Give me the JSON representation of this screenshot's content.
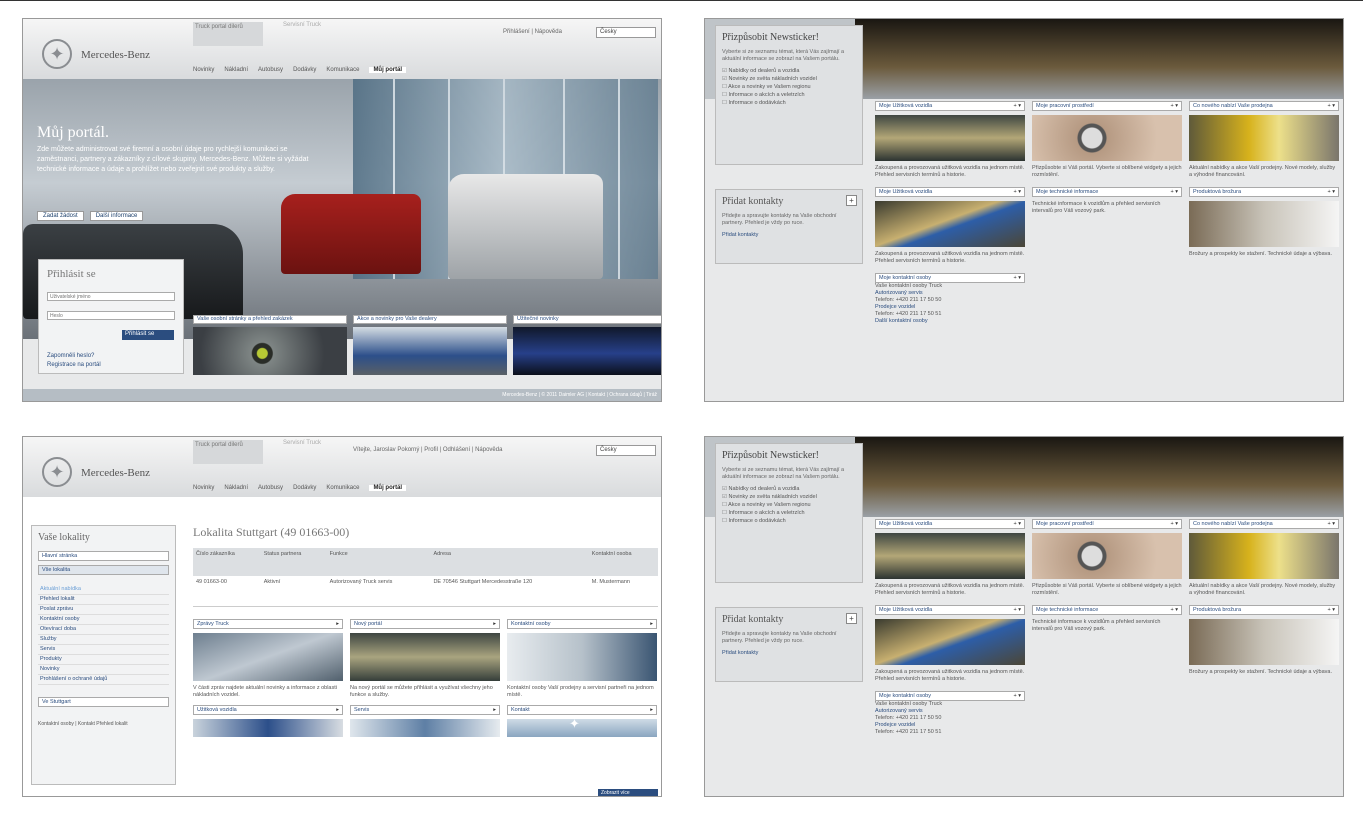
{
  "brand": {
    "name": "Mercedes-Benz"
  },
  "header": {
    "tab_active": "Truck portal\ndilerů",
    "tab_inactive": "Servisní Truck",
    "links_p1": "Přihlášení | Nápověda",
    "links_p3": "Vítejte, Jaroslav Pokorný | Profil | Odhlášení | Nápověda",
    "lang": "Česky",
    "nav": [
      "Novinky",
      "Nákladní",
      "Autobusy",
      "Dodávky",
      "Komunikace",
      "Můj portál"
    ]
  },
  "hero": {
    "title": "Můj portál.",
    "text": "Zde můžete administrovat své firemní a osobní údaje pro rychlejší komunikaci se zaměstnanci, partnery a zákazníky z cílové skupiny. Mercedes-Benz. Můžete si vyžádat technické informace a údaje a prohlížet nebo zveřejnit své produkty a služby.",
    "btn_register": "Zadat žádost",
    "btn_how": "Další informace"
  },
  "login": {
    "title": "Přihlásit se",
    "user_placeholder": "Uživatelské jméno",
    "pass_placeholder": "Heslo",
    "button": "Přihlásit se",
    "link_forgot": "Zapomněli heslo?",
    "link_register": "Registrace na portál"
  },
  "teasers": [
    "Vaše osobní stránky a přehled zakázek",
    "Akce a novinky pro Vaše dealery",
    "Užitečné novinky"
  ],
  "footer": "Mercedes-Benz | © 2011 Daimler AG | Kontakt | Ochrana údajů | Tiráž",
  "newsticker": {
    "title": "Přizpůsobit Newsticker!",
    "intro": "Vyberte si ze seznamu témat, která Vás zajímají a aktuální informace se zobrazí na Vašem portálu.",
    "options": [
      {
        "label": "Nabídky od dealerů a vozidla",
        "checked": true
      },
      {
        "label": "Novinky ze světa nákladních vozidel",
        "checked": true
      },
      {
        "label": "Akce a novinky ve Vašem regionu",
        "checked": false
      },
      {
        "label": "Informace o akcích a veletrzích",
        "checked": false
      },
      {
        "label": "Informace o dodávkách",
        "checked": false
      }
    ]
  },
  "quicklink": {
    "title": "Přidat kontakty",
    "text": "Přidejte a spravujte kontakty na Vaše obchodní partnery. Přehled je vždy po ruce.",
    "link": "Přidat kontakty"
  },
  "widgets": [
    {
      "title": "Moje Užitková vozidla",
      "text": "Zakoupená a provozovaná užitková vozidla na jednom místě. Přehled servisních termínů a historie."
    },
    {
      "title": "Moje pracovní prostředí",
      "text": "Přizpůsobte si Váš portál. Vyberte si oblíbené widgety a jejich rozmístění."
    },
    {
      "title": "Co nového nabízí Vaše prodejna",
      "text": "Aktuální nabídky a akce Vaší prodejny. Nové modely, služby a výhodné financování."
    },
    {
      "title": "Moje Užitková vozidla",
      "text": "Zakoupená a provozovaná užitková vozidla na jednom místě. Přehled servisních termínů a historie."
    },
    {
      "title": "Moje technické informace",
      "text": "Technické informace k vozidlům a přehled servisních intervalů pro Váš vozový park."
    },
    {
      "title": "Produktová brožura",
      "text": "Brožury a prospekty ke stažení. Technické údaje a výbava."
    }
  ],
  "contacts_widget": {
    "title": "Moje kontaktní osoby",
    "line1": "Vaše kontaktní osoby Truck",
    "line2": "Autorizovaný servis",
    "line3": "Telefon: +420 211 17 50 50",
    "line4": "Prodejce vozidel",
    "line5": "Telefon: +420 211 17 50 51",
    "link": "Další kontaktní osoby"
  },
  "portal": {
    "sidebar_title": "Vaše lokality",
    "sidebar_btn": "Hlavní stránka",
    "sidebar_sel": "Vše lokalita",
    "sidebar_items": [
      "Aktuální nabídka",
      "Přehled lokalit",
      "Poslat zprávu",
      "Kontaktní osoby",
      "Otevírací doba",
      "Služby",
      "Servis",
      "Produkty",
      "Novinky",
      "Prohlášení o ochraně údajů"
    ],
    "sidebar_sel2": "Ve Stuttgart",
    "sidebar_foot": "Kontaktní osoby | Kontakt\nPřehled lokalit",
    "heading": "Lokalita Stuttgart (49 01663-00)",
    "table_headers": [
      "Číslo zákazníka",
      "Status partnera",
      "Funkce",
      "Adresa",
      "Kontaktní osoba"
    ],
    "table_row": [
      "49 01663-00",
      "Aktivní",
      "Autorizovaný Truck servis",
      "DE 70546 Stuttgart Mercedesstraße 120",
      "M. Mustermann"
    ],
    "tiles": [
      "Zprávy Truck",
      "Nový portál",
      "Kontaktní osoby",
      "Užitková vozidla",
      "Servis",
      "Kontakt"
    ],
    "tile_texts": [
      "V části zpráv najdete aktuální novinky a informace z oblasti nákladních vozidel.",
      "Na nový portál se můžete přihlásit a využívat všechny jeho funkce a služby.",
      "Kontaktní osoby Vaší prodejny a servisní partneři na jednom místě."
    ],
    "bottom_btn": "Zobrazit více"
  },
  "colors": {
    "brand_blue": "#2b4d7f",
    "panel_bg": "#e8e9ea",
    "header_bg": "#d9dbdd"
  }
}
